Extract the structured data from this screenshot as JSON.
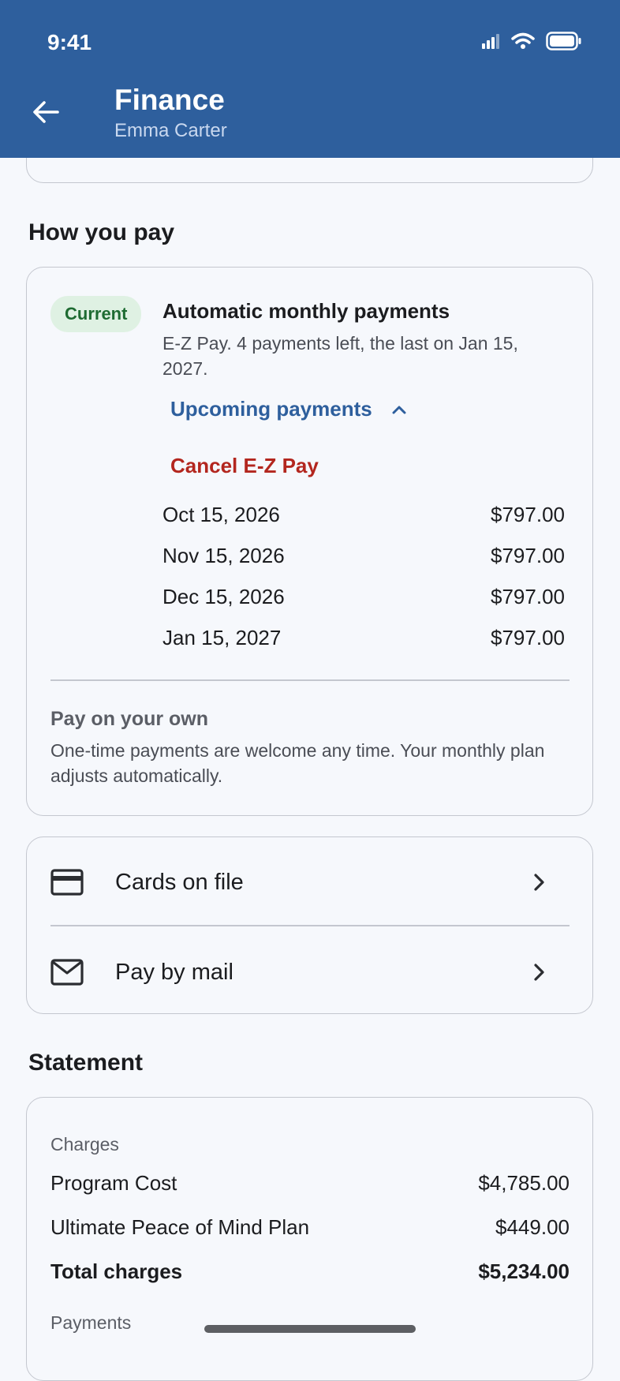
{
  "status_bar": {
    "time": "9:41"
  },
  "header": {
    "title": "Finance",
    "subtitle": "Emma Carter"
  },
  "how_you_pay": {
    "section_title": "How you pay",
    "badge": "Current",
    "plan_title": "Automatic monthly payments",
    "plan_desc": "E-Z Pay. 4 payments left, the last on Jan 15, 2027.",
    "upcoming_label": "Upcoming payments",
    "cancel_label": "Cancel E-Z Pay",
    "payments": [
      {
        "date": "Oct 15, 2026",
        "amount": "$797.00"
      },
      {
        "date": "Nov 15, 2026",
        "amount": "$797.00"
      },
      {
        "date": "Dec 15, 2026",
        "amount": "$797.00"
      },
      {
        "date": "Jan 15, 2027",
        "amount": "$797.00"
      }
    ],
    "own_title": "Pay on your own",
    "own_desc": "One-time payments are welcome any time. Your monthly plan adjusts automatically."
  },
  "options": [
    {
      "label": "Cards on file",
      "icon": "credit-card-icon"
    },
    {
      "label": "Pay by mail",
      "icon": "mail-icon"
    }
  ],
  "statement": {
    "section_title": "Statement",
    "charges_label": "Charges",
    "charges": [
      {
        "label": "Program Cost",
        "amount": "$4,785.00"
      },
      {
        "label": "Ultimate Peace of Mind Plan",
        "amount": "$449.00"
      }
    ],
    "total_label": "Total charges",
    "total_amount": "$5,234.00",
    "payments_label": "Payments"
  },
  "colors": {
    "header": "#2e5f9d",
    "accent": "#2e5f9d",
    "danger": "#b3261e",
    "badge_bg": "#dff1e3",
    "badge_text": "#1e6b32"
  }
}
